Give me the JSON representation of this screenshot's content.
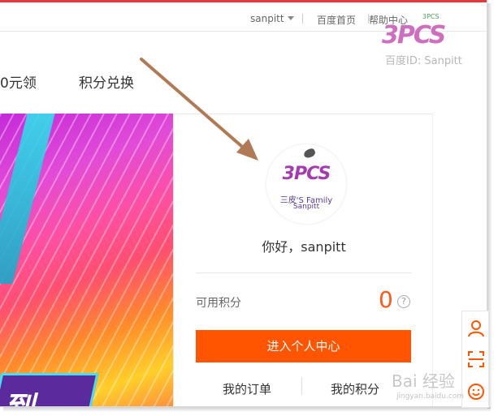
{
  "topbar": {
    "username": "sanpitt",
    "home_link": "百度首页",
    "help_link": "帮助中心"
  },
  "nav": {
    "item1": "0元领",
    "item2": "积分兑换"
  },
  "banner": {
    "promo_text": "到"
  },
  "card": {
    "greeting": "你好，sanpitt",
    "points_label": "可用积分",
    "points_value": "0",
    "help_glyph": "?",
    "enter_button": "进入个人中心",
    "orders_link": "我的订单",
    "points_link": "我的积分"
  },
  "avatar_logo": {
    "brand": "3PCS",
    "family": "三皮'S Family",
    "name": "Sanpitt"
  },
  "watermark": {
    "logo_text": "3PCS",
    "pcs_small": "3PCS",
    "id_text": "百度ID: Sanpitt",
    "baidu_text": "Bai 经验",
    "baidu_url": "jingyan.baidu.com"
  },
  "colors": {
    "accent": "#ff5500",
    "points": "#ff5a1a",
    "top_line": "#e4393c",
    "arrow": "#b07a55"
  },
  "icons": [
    "user-icon",
    "scan-icon",
    "smile-icon",
    "caret-down-icon",
    "help-circle-icon"
  ]
}
